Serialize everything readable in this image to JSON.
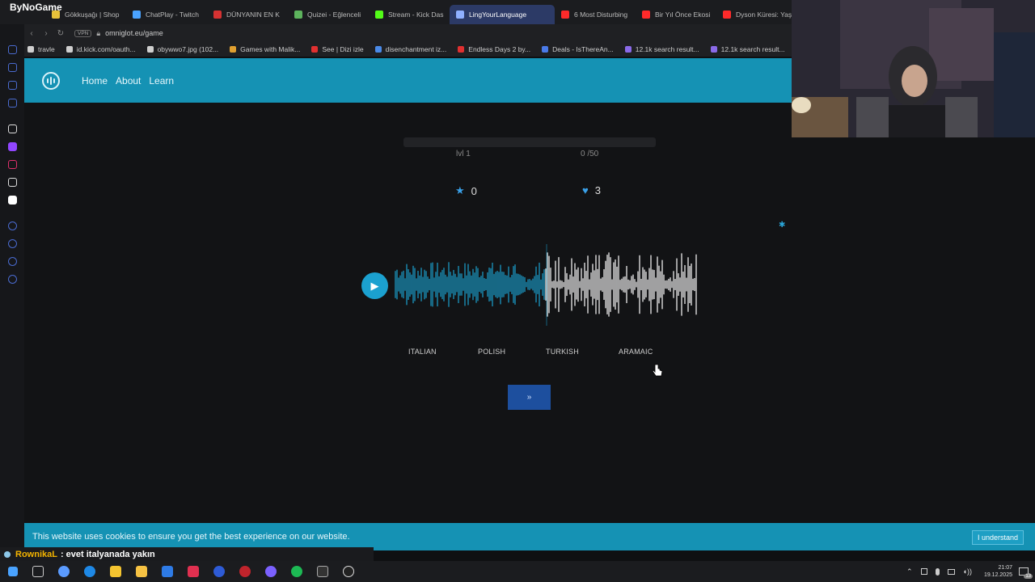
{
  "brand": "ByNoGame",
  "tabs": [
    {
      "label": "Gökkuşağı | Shop",
      "color": "#e8c23a"
    },
    {
      "label": "ChatPlay - Twitch",
      "color": "#4aa3ff"
    },
    {
      "label": "DÜNYANIN EN K",
      "color": "#d63232"
    },
    {
      "label": "Quizei - Eğlenceli",
      "color": "#5db35d"
    },
    {
      "label": "Stream - Kick Das",
      "color": "#53fc18"
    },
    {
      "label": "LingYourLanguage",
      "color": "#8fb0ff"
    },
    {
      "label": "6 Most Disturbing",
      "color": "#ff2a2a"
    },
    {
      "label": "Bir Yıl Önce Ekosi",
      "color": "#ff2a2a"
    },
    {
      "label": "Dyson Küresi: Yaş",
      "color": "#ff2a2a"
    }
  ],
  "active_tab_index": 5,
  "address": {
    "vpn": "VPN",
    "url": "omniglot.eu/game"
  },
  "bookmarks": [
    {
      "label": "travle",
      "color": "#cfcfcf"
    },
    {
      "label": "id.kick.com/oauth...",
      "color": "#cfcfcf"
    },
    {
      "label": "obywwo7.jpg (102...",
      "color": "#cfcfcf"
    },
    {
      "label": "Games with Malik...",
      "color": "#e0a030"
    },
    {
      "label": "See | Dizi izle",
      "color": "#e03030"
    },
    {
      "label": "disenchantment iz...",
      "color": "#4a8ae8"
    },
    {
      "label": "Endless Days 2 by...",
      "color": "#e03030"
    },
    {
      "label": "Deals - IsThereAn...",
      "color": "#4a7ae8"
    },
    {
      "label": "12.1k search result...",
      "color": "#8a6ae8"
    },
    {
      "label": "12.1k search result...",
      "color": "#8a6ae8"
    }
  ],
  "site_nav": {
    "links": [
      "Home",
      "About",
      "Learn"
    ]
  },
  "game": {
    "level": "lvl 1",
    "progress_text": "0 /50",
    "progress_fraction": 0,
    "score": "0",
    "lives": "3",
    "played_fraction": 0.5,
    "options": [
      "ITALIAN",
      "POLISH",
      "TURKISH",
      "ARAMAIC"
    ],
    "next_label": "»"
  },
  "cookie": {
    "message": "This website uses cookies to ensure you get the best experience on our website.",
    "button": "I understand"
  },
  "chat": {
    "user": "RownikaL",
    "message": ": evet italyanada yakın"
  },
  "clock": {
    "time": "21:07",
    "date": "19.12.2025"
  },
  "notification_count": "13",
  "colors": {
    "accent": "#1592b4",
    "wave_played": "#1ba1d0",
    "wave_unplayed": "#ffffff",
    "next_button": "#1d4f9e"
  }
}
